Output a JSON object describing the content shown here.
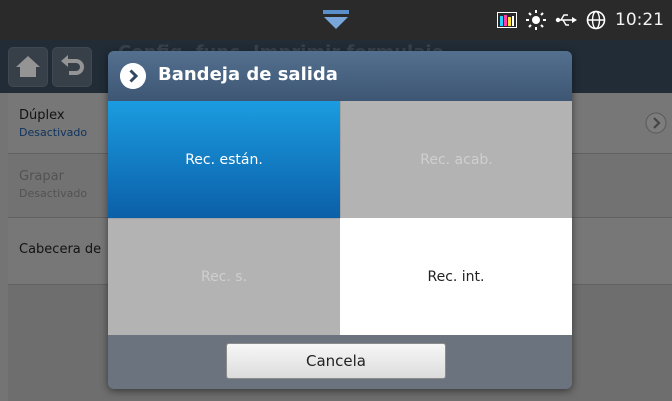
{
  "status_bar": {
    "time": "10:21",
    "icons": [
      "down-handle-icon",
      "toner-level-icon",
      "brightness-icon",
      "usb-icon",
      "globe-icon"
    ]
  },
  "title_bar": {
    "icons": [
      "home-icon",
      "back-icon"
    ],
    "title": "Config. func. Imprimir formulaio"
  },
  "settings_list": {
    "items": [
      {
        "label": "Dúplex",
        "value": "Desactivado"
      },
      {
        "label": "Grapar",
        "value": "Desactivado"
      },
      {
        "label": "Cabecera de"
      }
    ]
  },
  "dialog": {
    "title": "Bandeja de salida",
    "options": [
      {
        "label": "Rec. están.",
        "state": "selected"
      },
      {
        "label": "Rec. acab.",
        "state": "disabled"
      },
      {
        "label": "Rec. s.",
        "state": "disabled"
      },
      {
        "label": "Rec. int.",
        "state": "normal"
      }
    ],
    "cancel_label": "Cancela"
  },
  "colors": {
    "selected": "#0c63ae",
    "header": "#476380",
    "status_bar": "#2a2a2a"
  }
}
